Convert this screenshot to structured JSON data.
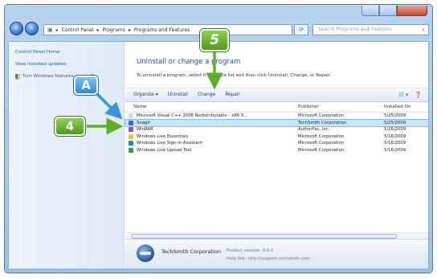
{
  "breadcrumb": [
    "Control Panel",
    "Programs",
    "Programs and Features"
  ],
  "search_placeholder": "Search Programs and Features",
  "left_pane": {
    "items": [
      "Control Panel Home",
      "View installed updates",
      "Turn Windows features on or off"
    ]
  },
  "main": {
    "heading": "Uninstall or change a program",
    "description": "To uninstall a program, select it from the list and then click Uninstall, Change, or Repair."
  },
  "toolbar": {
    "organize": "Organize ▾",
    "uninstall": "Uninstall",
    "change": "Change",
    "repair": "Repair"
  },
  "columns": [
    "Name",
    "Publisher",
    "Installed On"
  ],
  "programs": [
    {
      "name": "Microsoft Visual C++ 2008 Redistributable - x86 9...",
      "publisher": "Microsoft Corporation",
      "date": "5/25/2009",
      "icon_color": "#d9d9d9"
    },
    {
      "name": "Snagit",
      "publisher": "TechSmith Corporation",
      "date": "5/25/2009",
      "icon_color": "#2f6fc0",
      "selected": true
    },
    {
      "name": "WinRAR",
      "publisher": "AutherFac, Inc.",
      "date": "5/26/2009",
      "icon_color": "#8a4fc7"
    },
    {
      "name": "Windows Live Essentials",
      "publisher": "Microsoft Corporation",
      "date": "5/16/2009",
      "icon_color": "#e8c53a"
    },
    {
      "name": "Windows Live Sign-in Assistant",
      "publisher": "Microsoft Corporation",
      "date": "5/16/2009",
      "icon_color": "#2b7fd4"
    },
    {
      "name": "Windows Live Upload Tool",
      "publisher": "Microsoft Corporation",
      "date": "5/16/2009",
      "icon_color": "#3a9b4a"
    }
  ],
  "footer": {
    "publisher": "TechSmith Corporation",
    "version_label": "Product version: 9.0.0",
    "help_link": "Help link: http://support.techsmith.com"
  },
  "callouts": {
    "four": "4",
    "five": "5",
    "a": "A"
  },
  "colors": {
    "green_callout": "#5fae2a",
    "blue_callout": "#3b95dc",
    "selection": "#cde3fb"
  }
}
